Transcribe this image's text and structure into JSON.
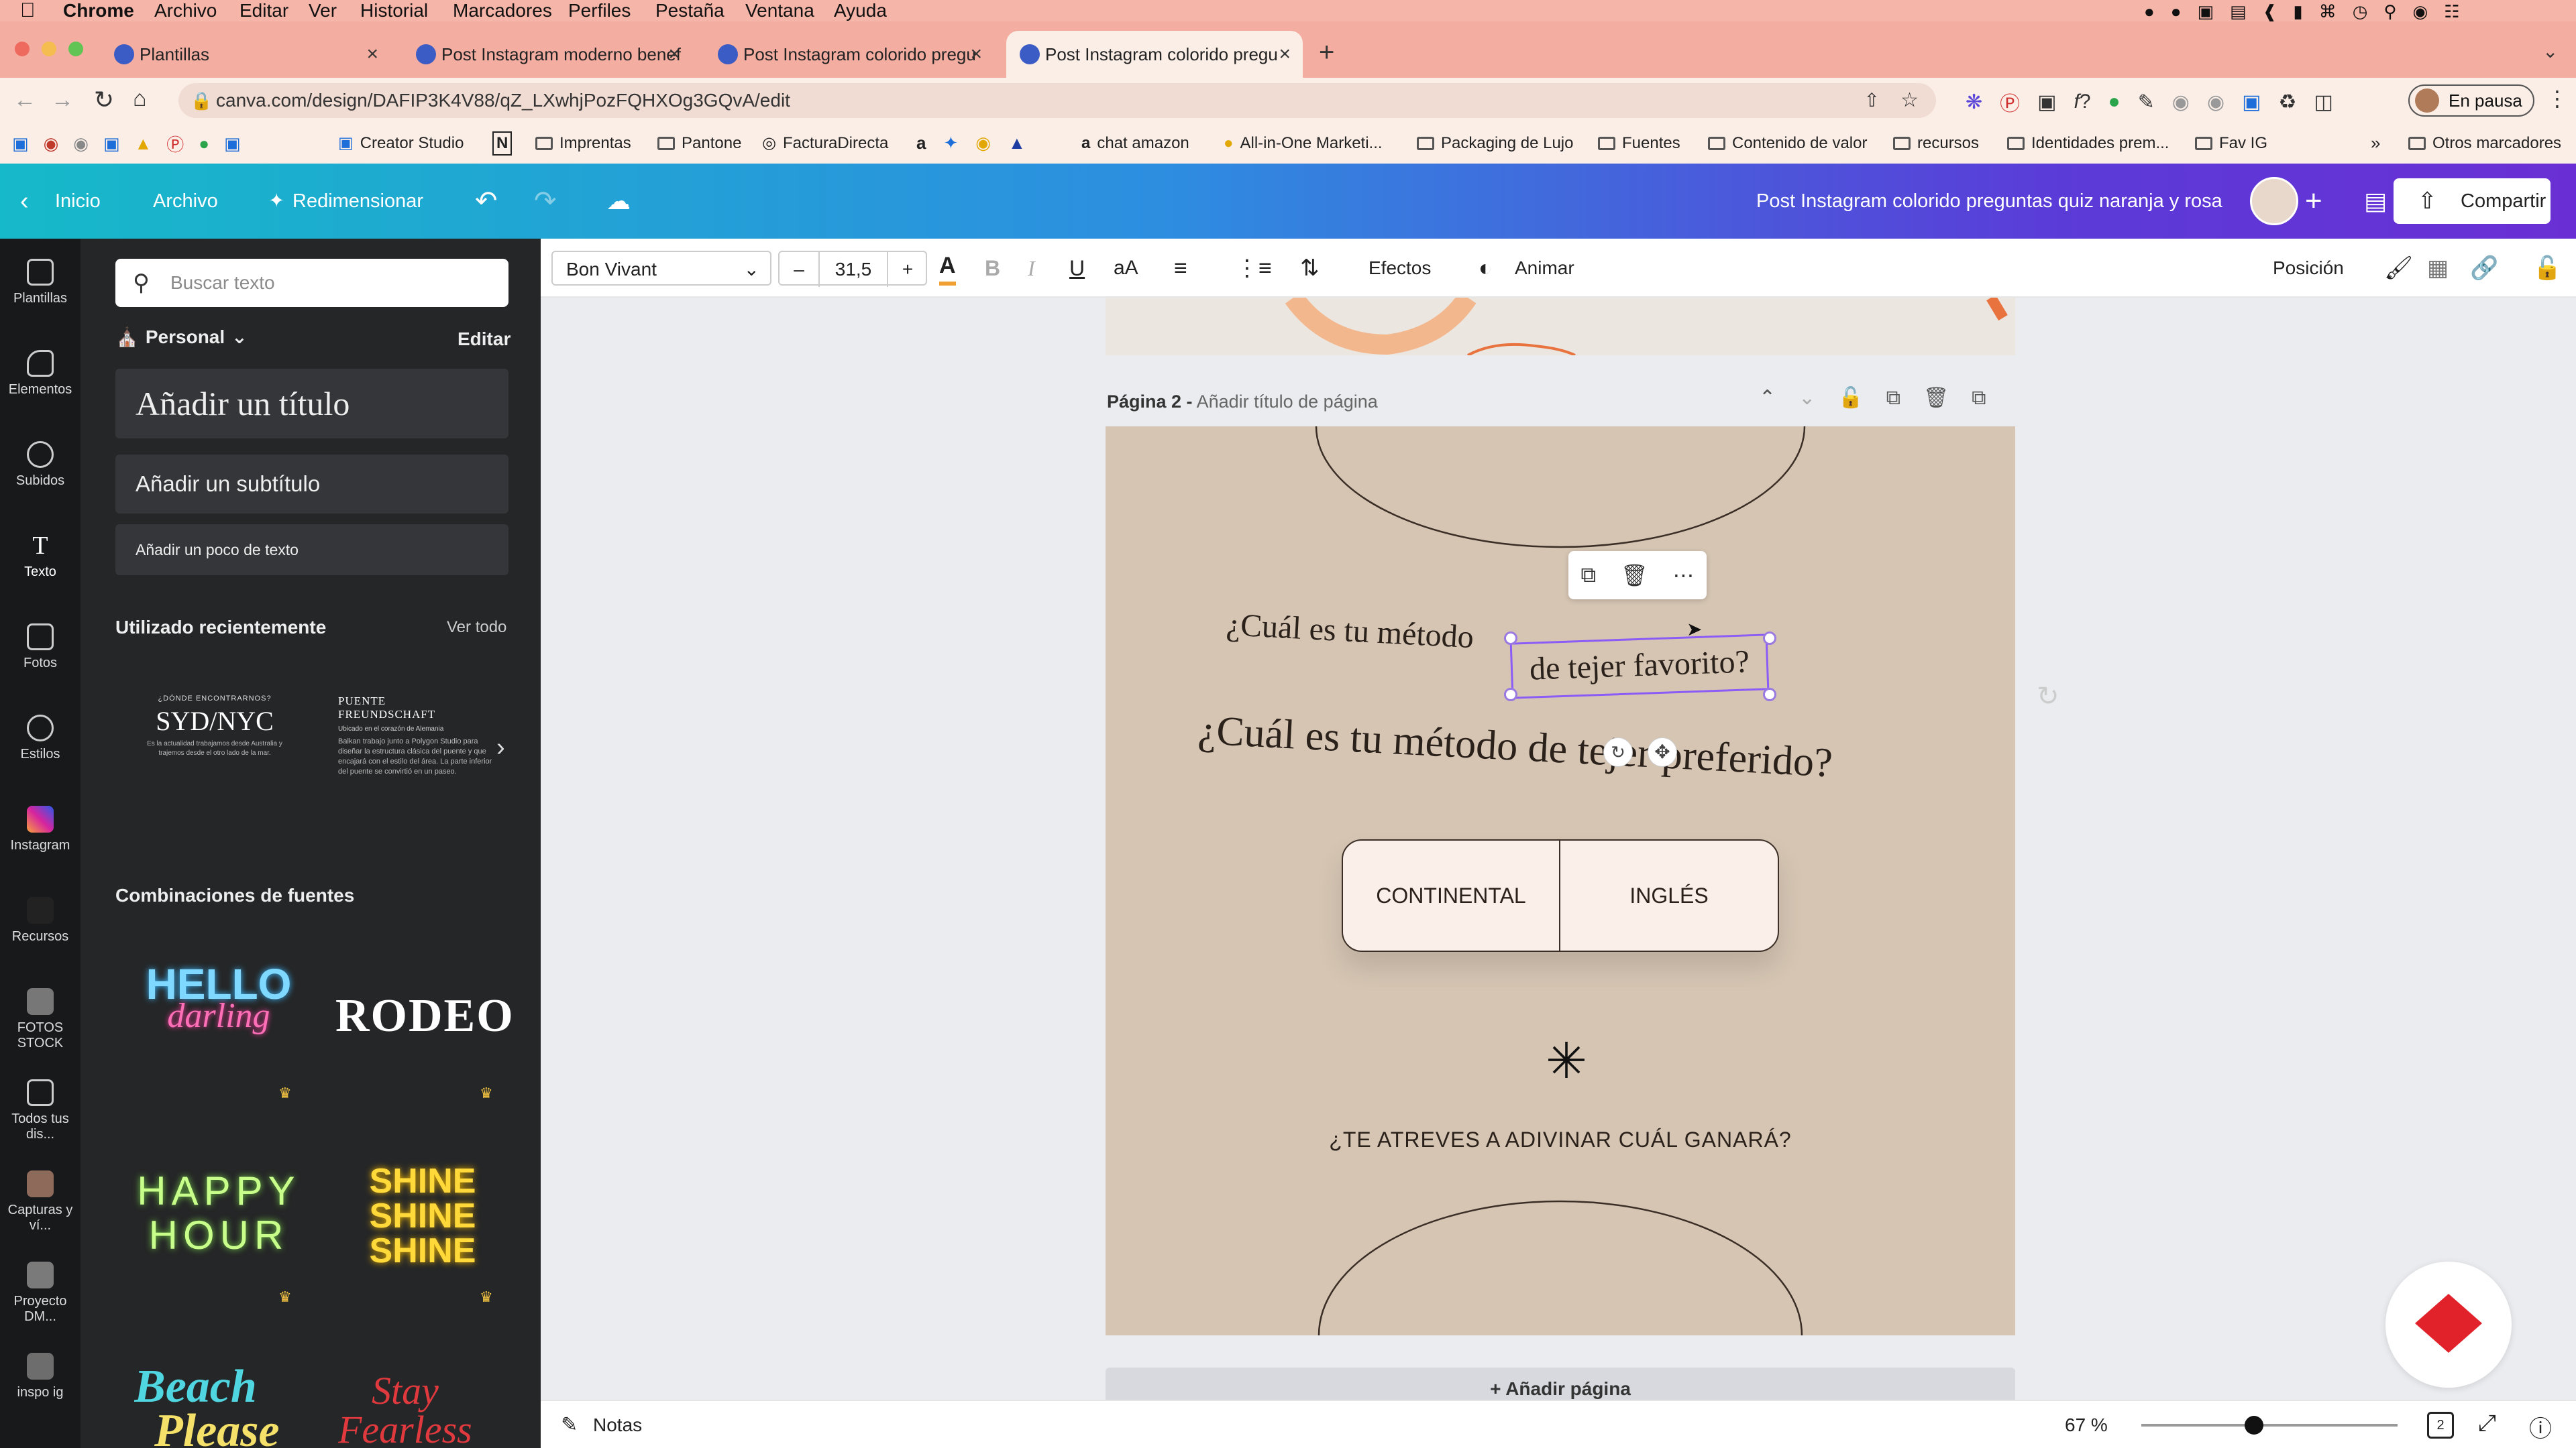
{
  "menubar": {
    "app": "Chrome",
    "items": [
      "Archivo",
      "Editar",
      "Ver",
      "Historial",
      "Marcadores",
      "Perfiles",
      "Pestaña",
      "Ventana",
      "Ayuda"
    ]
  },
  "tabs": [
    {
      "title": "Plantillas",
      "active": false
    },
    {
      "title": "Post Instagram moderno benef",
      "active": false
    },
    {
      "title": "Post Instagram colorido pregu",
      "active": false
    },
    {
      "title": "Post Instagram colorido pregu",
      "active": true
    }
  ],
  "url": "canva.com/design/DAFIP3K4V88/qZ_LXwhjPozFQHXOg3GQvA/edit",
  "profile_label": "En pausa",
  "bookmarks": [
    "Creator Studio",
    "Imprentas",
    "Pantone",
    "FacturaDirecta",
    "chat amazon",
    "All-in-One Marketi...",
    "Packaging de Lujo",
    "Fuentes",
    "Contenido de valor",
    "recursos",
    "Identidades prem...",
    "Fav IG",
    "Otros marcadores"
  ],
  "canva_header": {
    "home": "Inicio",
    "file": "Archivo",
    "resize": "Redimensionar",
    "design_title": "Post Instagram colorido preguntas quiz naranja y rosa",
    "share": "Compartir"
  },
  "format_bar": {
    "font": "Bon Vivant",
    "size": "31,5",
    "effects": "Efectos",
    "animate": "Animar",
    "position": "Posición"
  },
  "rail": [
    "Plantillas",
    "Elementos",
    "Subidos",
    "Texto",
    "Fotos",
    "Estilos",
    "Instagram",
    "Recursos",
    "FOTOS STOCK",
    "Todos tus dis...",
    "Capturas y ví...",
    "Proyecto DM...",
    "inspo ig"
  ],
  "panel": {
    "search_placeholder": "Buscar texto",
    "brand": "Personal",
    "edit": "Editar",
    "add_title": "Añadir un título",
    "add_subtitle": "Añadir un subtítulo",
    "add_body": "Añadir un poco de texto",
    "recent_heading": "Utilizado recientemente",
    "see_all": "Ver todo",
    "recent1_top": "¿DÓNDE ENCONTRARNOS?",
    "recent1_main": "SYD/NYC",
    "recent1_body": "Es la actualidad trabajamos desde Australia y trajemos desde el otro lado de la mar.",
    "recent2_title": "PUENTE FREUNDSCHAFT",
    "recent2_sub": "Ubicado en el corazón de Alemania",
    "recent2_body": "Balkan trabajo junto a Polygon Studio para diseñar la estructura clásica del puente y que encajará con el estilo del área. La parte inferior del puente se convirtió en un paseo.",
    "combos_heading": "Combinaciones de fuentes",
    "combo_hello": "HELLO",
    "combo_darling": "darling",
    "combo_rodeo": "RODEO",
    "combo_happy": "HAPPY",
    "combo_hour": "HOUR",
    "combo_shine": "SHINE",
    "combo_beach": "Beach",
    "combo_please": "Please",
    "combo_stay": "Stay",
    "combo_fearless": "Fearless"
  },
  "page_header": {
    "label": "Página 2 -",
    "placeholder": "Añadir título de página"
  },
  "design": {
    "question1": "¿Cuál es tu método",
    "selected_text": "de tejer favorito?",
    "question2": "¿Cuál es tu método de tejer preferido?",
    "option1": "CONTINENTAL",
    "option2": "INGLÉS",
    "footer": "¿TE ATREVES A ADIVINAR CUÁL GANARÁ?"
  },
  "add_page": "+ Añadir página",
  "bottom": {
    "notes": "Notas",
    "zoom": "67 %",
    "zoom_fraction": 0.44,
    "page_count": "2"
  },
  "colors": {
    "canvas_bg": "#d6c5b3",
    "panel_bg": "#252627",
    "selection": "#8b5cf6"
  }
}
